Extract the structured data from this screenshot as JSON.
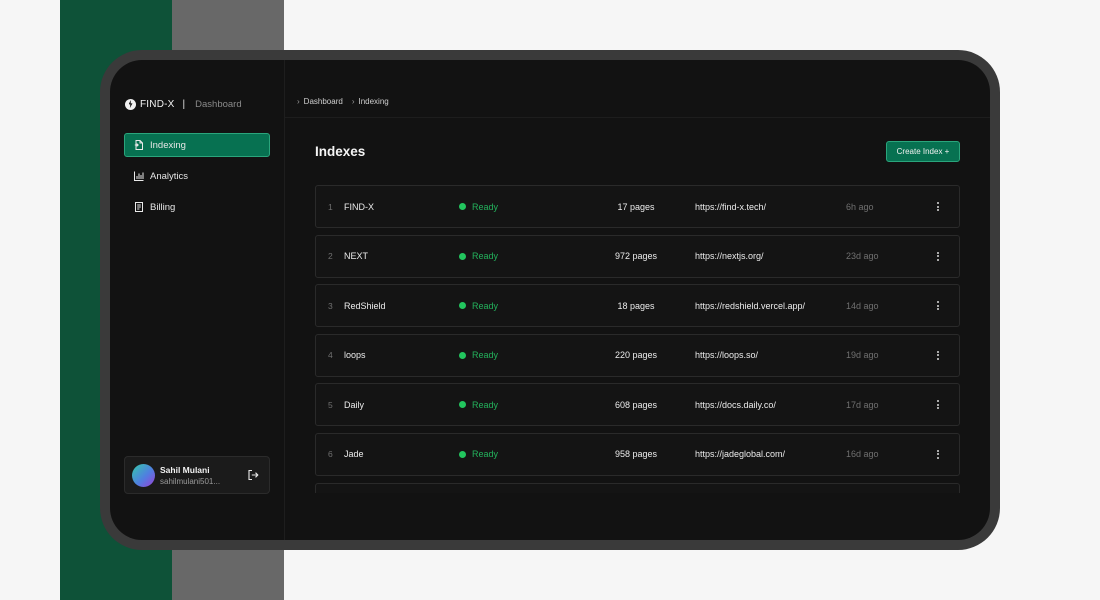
{
  "brand": {
    "name": "FIND-X",
    "separator": "|",
    "section": "Dashboard"
  },
  "sidebar": {
    "items": [
      {
        "label": "Indexing",
        "icon": "file-index-icon",
        "active": true
      },
      {
        "label": "Analytics",
        "icon": "bar-chart-icon",
        "active": false
      },
      {
        "label": "Billing",
        "icon": "receipt-icon",
        "active": false
      }
    ]
  },
  "user": {
    "name": "Sahil Mulani",
    "email": "sahilmulani501...",
    "logout_icon": "logout-icon"
  },
  "breadcrumb": {
    "items": [
      "Dashboard",
      "Indexing"
    ]
  },
  "page": {
    "title": "Indexes",
    "create_button": "Create Index +"
  },
  "indexes": [
    {
      "num": "1",
      "name": "FIND-X",
      "status": "Ready",
      "pages": "17 pages",
      "url": "https://find-x.tech/",
      "time": "6h ago"
    },
    {
      "num": "2",
      "name": "NEXT",
      "status": "Ready",
      "pages": "972 pages",
      "url": "https://nextjs.org/",
      "time": "23d ago"
    },
    {
      "num": "3",
      "name": "RedShield",
      "status": "Ready",
      "pages": "18 pages",
      "url": "https://redshield.vercel.app/",
      "time": "14d ago"
    },
    {
      "num": "4",
      "name": "loops",
      "status": "Ready",
      "pages": "220 pages",
      "url": "https://loops.so/",
      "time": "19d ago"
    },
    {
      "num": "5",
      "name": "Daily",
      "status": "Ready",
      "pages": "608 pages",
      "url": "https://docs.daily.co/",
      "time": "17d ago"
    },
    {
      "num": "6",
      "name": "Jade",
      "status": "Ready",
      "pages": "958 pages",
      "url": "https://jadeglobal.com/",
      "time": "16d ago"
    },
    {
      "num": "",
      "name": "",
      "status": "",
      "pages": "",
      "url": "",
      "time": ""
    }
  ],
  "colors": {
    "accent": "#077151",
    "accent_border": "#2aa57c",
    "status_ready": "#22c55e",
    "background": "#121212",
    "frame": "#3a3a3a",
    "bg_green": "#0e5238",
    "bg_gray": "#686868"
  }
}
